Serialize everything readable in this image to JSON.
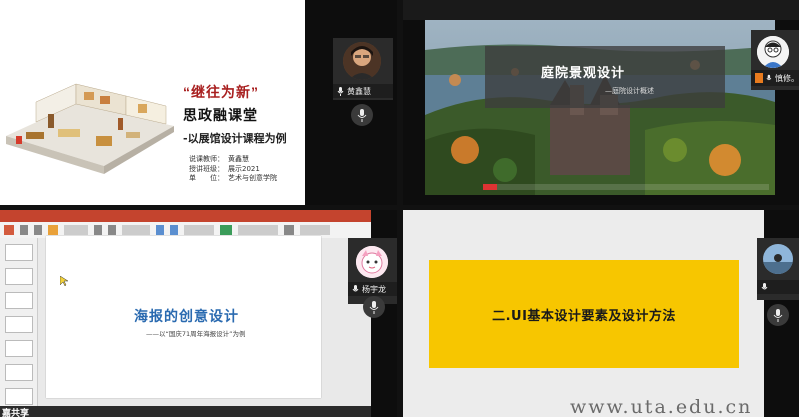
{
  "q1": {
    "title_quote_open": "“",
    "title_highlight": "继往为新",
    "title_quote_close": "”",
    "title_line2": "思政融课堂",
    "title_line3": "-以展馆设计课程为例",
    "info": [
      {
        "label": "说课教师：",
        "value": "黄鑫慧"
      },
      {
        "label": "授讲班级：",
        "value": "展示2021"
      },
      {
        "label": "单　　位：",
        "value": "艺术与创意学院"
      }
    ],
    "user_name": "黄鑫慧"
  },
  "q2": {
    "caption_title": "庭院景观设计",
    "caption_sub": "—庭院设计概述",
    "progress": 0.05,
    "user_name": "慎修。"
  },
  "q3": {
    "slide_title": "海报的创意设计",
    "slide_sub": "——以“国庆71周年海报设计”为例",
    "user_name": "杨宇龙",
    "taskbar_text": "嘉共享"
  },
  "q4": {
    "slide_text": "二.UI基本设计要素及设计方法"
  },
  "watermark": "www.uta.edu.cn",
  "colors": {
    "accent_red": "#a81f1f",
    "ppt_ribbon": "#c4442e",
    "slide_yellow": "#f7c600",
    "slide_blue": "#2a6ab0"
  }
}
